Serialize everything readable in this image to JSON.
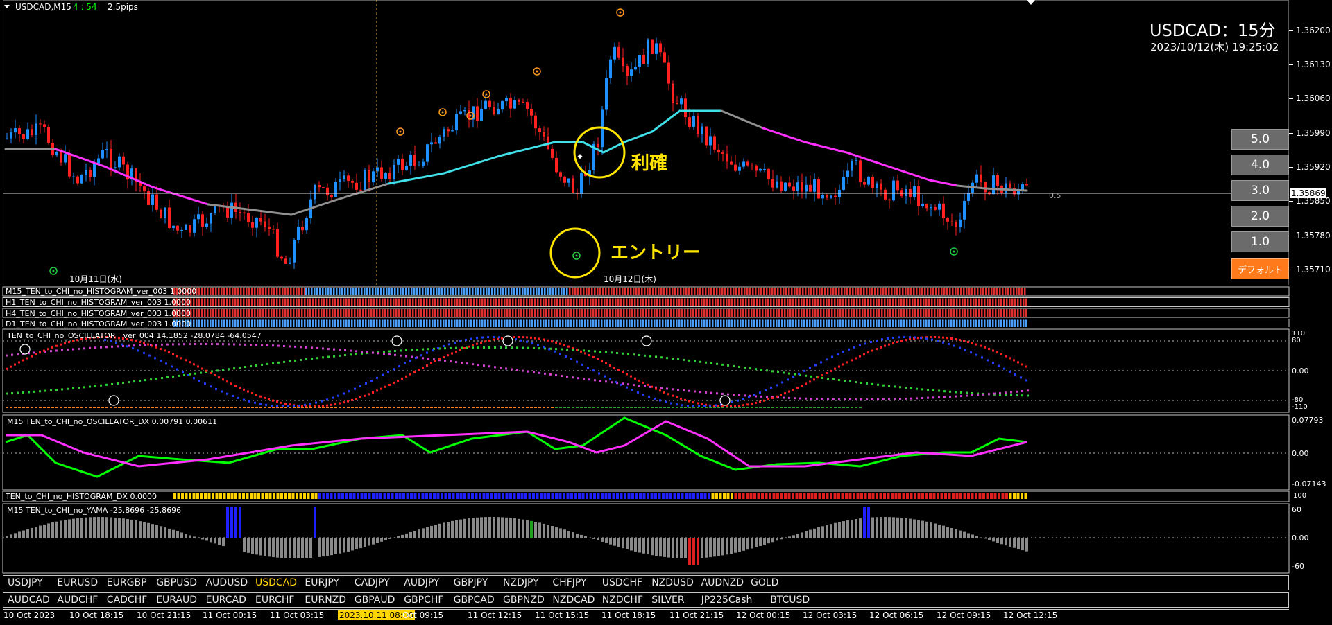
{
  "chart_header": {
    "symbol_timeframe": "USDCAD,M15",
    "countdown": "4 : 54",
    "spread": "2.5pips"
  },
  "overlay": {
    "pair_timeframe": "USDCAD：15分",
    "datetime": "2023/10/12(木) 19:25:02"
  },
  "annotations": {
    "take_profit": "利確",
    "entry": "エントリー"
  },
  "day_labels": [
    "10月11日(水)",
    "10月12日(木)"
  ],
  "price_axis": {
    "ticks": [
      "1.36200",
      "1.36130",
      "1.36060",
      "1.35990",
      "1.35920",
      "1.35850",
      "1.35780",
      "1.35710"
    ],
    "current": "1.35869",
    "level_label": "0.5"
  },
  "side_buttons": [
    "5.0",
    "4.0",
    "3.0",
    "2.0",
    "1.0",
    "デフォルト"
  ],
  "histogram_rows": [
    "M15_TEN_to_CHI_no_HISTOGRAM_ver_003 1.0000",
    "H1_TEN_to_CHI_no_HISTOGRAM_ver_003 1.0000",
    "H4_TEN_to_CHI_no_HISTOGRAM_ver_003 1.0000",
    "D1_TEN_to_CHI_no_HISTOGRAM_ver_003 1.0000"
  ],
  "oscillator": {
    "label": "TEN_to_CHI_no_OSCILLATOR__ver_004 14.1852 -28.0784 -64.0547",
    "axis": [
      "110",
      "80",
      "0.00",
      "-80",
      "-110"
    ]
  },
  "dx": {
    "label": "M15 TEN_to_CHI_no_OSCILLATOR_DX  0.00791 0.00611",
    "axis": [
      "0.07793",
      "0.00",
      "-0.07143"
    ]
  },
  "histogram_dx": {
    "label": "TEN_to_CHI_no_HISTOGRAM_DX 0.0000",
    "axis": "100"
  },
  "yama": {
    "label": "M15  TEN_to_CHI_no_YAMA  -25.8696 -25.8696",
    "axis": [
      "60",
      "0.00",
      "-60"
    ]
  },
  "symbols_row1": [
    "USDJPY",
    "EURUSD",
    "EURGBP",
    "GBPUSD",
    "AUDUSD",
    "USDCAD",
    "EURJPY",
    "CADJPY",
    "AUDJPY",
    "GBPJPY",
    "NZDJPY",
    "CHFJPY",
    "USDCHF",
    "NZDUSD",
    "AUDNZD",
    "GOLD"
  ],
  "symbols_row2": [
    "AUDCAD",
    "AUDCHF",
    "CADCHF",
    "EURAUD",
    "EURCAD",
    "EURCHF",
    "EURNZD",
    "GBPAUD",
    "GBPCHF",
    "GBPCAD",
    "GBPNZD",
    "NZDCAD",
    "NZDCHF",
    "SILVER",
    "JP225Cash",
    "BTCUSD"
  ],
  "active_symbol": "USDCAD",
  "time_axis": [
    "10 Oct 2023",
    "10 Oct 18:15",
    "10 Oct 21:15",
    "11 Oct 00:15",
    "11 Oct 03:15",
    "2023.10.11 08:00",
    "Oct 09:15",
    "11 Oct 12:15",
    "11 Oct 15:15",
    "11 Oct 18:15",
    "11 Oct 21:15",
    "12 Oct 00:15",
    "12 Oct 03:15",
    "12 Oct 06:15",
    "12 Oct 09:15",
    "12 Oct 12:15"
  ],
  "colors": {
    "bull": "#1e90ff",
    "bear": "#ff2020",
    "ma_up": "#40e0e8",
    "ma_down": "#ff30ff",
    "ma_flat": "#909090",
    "accent": "#ffe400",
    "oscillator_green": "#00ff00",
    "oscillator_magenta": "#ff30ff",
    "histo_blue": "#4aa0ff",
    "histo_red": "#e03030"
  }
}
